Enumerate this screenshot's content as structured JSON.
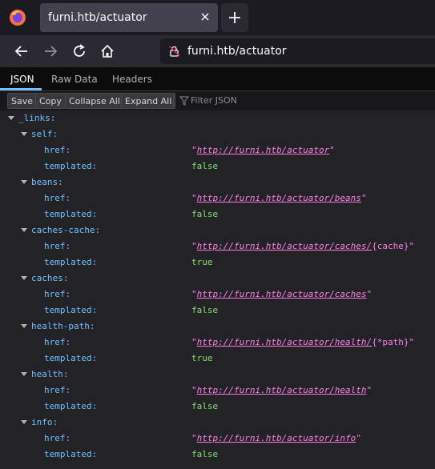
{
  "browser": {
    "tab_title": "furni.htb/actuator",
    "url": "furni.htb/actuator"
  },
  "viewer": {
    "tabs": [
      "JSON",
      "Raw Data",
      "Headers"
    ],
    "toolbar": {
      "save": "Save",
      "copy": "Copy",
      "collapse_all": "Collapse All",
      "expand_all": "Expand All",
      "filter_placeholder": "Filter JSON"
    }
  },
  "json": {
    "root_key": "_links:",
    "entries": [
      {
        "name": "self:",
        "href_key": "href:",
        "href": "http://furni.htb/actuator",
        "href_suffix": "",
        "templated_key": "templated:",
        "templated": "false"
      },
      {
        "name": "beans:",
        "href_key": "href:",
        "href": "http://furni.htb/actuator/beans",
        "href_suffix": "",
        "templated_key": "templated:",
        "templated": "false"
      },
      {
        "name": "caches-cache:",
        "href_key": "href:",
        "href": "http://furni.htb/actuator/caches/",
        "href_suffix": "{cache}",
        "templated_key": "templated:",
        "templated": "true"
      },
      {
        "name": "caches:",
        "href_key": "href:",
        "href": "http://furni.htb/actuator/caches",
        "href_suffix": "",
        "templated_key": "templated:",
        "templated": "false"
      },
      {
        "name": "health-path:",
        "href_key": "href:",
        "href": "http://furni.htb/actuator/health/",
        "href_suffix": "{*path}",
        "templated_key": "templated:",
        "templated": "true"
      },
      {
        "name": "health:",
        "href_key": "href:",
        "href": "http://furni.htb/actuator/health",
        "href_suffix": "",
        "templated_key": "templated:",
        "templated": "false"
      },
      {
        "name": "info:",
        "href_key": "href:",
        "href": "http://furni.htb/actuator/info",
        "href_suffix": "",
        "templated_key": "templated:",
        "templated": "false"
      }
    ]
  }
}
